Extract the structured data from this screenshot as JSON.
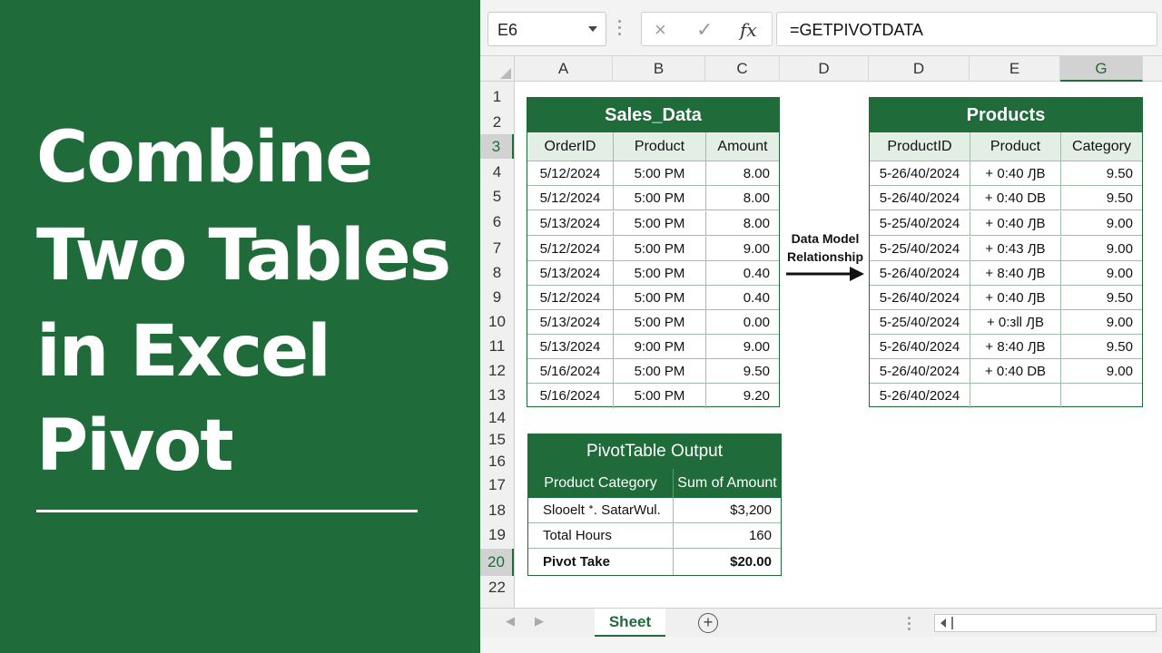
{
  "title_panel": {
    "lines": [
      "Combine",
      "Two Tables",
      "in Excel",
      "Pivot"
    ]
  },
  "formula_bar": {
    "name_box": "E6",
    "cancel_icon": "×",
    "enter_icon": "✓",
    "fx_icon": "fx",
    "formula": "=GETPIVOTDATA"
  },
  "grid": {
    "columns": [
      "A",
      "B",
      "C",
      "D",
      "D",
      "E",
      "G"
    ],
    "rows": [
      "1",
      "2",
      "3",
      "4",
      "5",
      "6",
      "7",
      "8",
      "9",
      "10",
      "11",
      "12",
      "13",
      "14",
      "15",
      "16",
      "17",
      "18",
      "19",
      "20",
      "22"
    ],
    "active_column": "G",
    "active_rows": [
      "3",
      "20"
    ]
  },
  "sales_data": {
    "title": "Sales_Data",
    "headers": [
      "OrderID",
      "Product",
      "Amount"
    ],
    "rows": [
      [
        "5/12/2024",
        "5:00 PM",
        "8.00"
      ],
      [
        "5/12/2024",
        "5:00 PM",
        "8.00"
      ],
      [
        "5/13/2024",
        "5:00 PM",
        "8.00"
      ],
      [
        "5/12/2024",
        "5:00 PM",
        "9.00"
      ],
      [
        "5/13/2024",
        "5:00 PM",
        "0.40"
      ],
      [
        "5/12/2024",
        "5:00 PM",
        "0.40"
      ],
      [
        "5/13/2024",
        "5:00 PM",
        "0.00"
      ],
      [
        "5/13/2024",
        "9:00 PM",
        "9.00"
      ],
      [
        "5/16/2024",
        "5:00 PM",
        "9.50"
      ],
      [
        "5/16/2024",
        "5:00 PM",
        "9.20"
      ]
    ]
  },
  "products": {
    "title": "Products",
    "headers": [
      "ProductID",
      "Product",
      "Category"
    ],
    "rows": [
      [
        "5-26/40/2024",
        "+ 0:40 ԒB",
        "9.50"
      ],
      [
        "5-26/40/2024",
        "+ 0:40 DB",
        "9.50"
      ],
      [
        "5-25/40/2024",
        "+ 0:40 ԒB",
        "9.00"
      ],
      [
        "5-25/40/2024",
        "+ 0:43 ԒB",
        "9.00"
      ],
      [
        "5-26/40/2024",
        "+ 8:40 ԒB",
        "9.00"
      ],
      [
        "5-26/40/2024",
        "+ 0:40 ԒB",
        "9.50"
      ],
      [
        "5-25/40/2024",
        "+ 0:ᴈll ԒB",
        "9.00"
      ],
      [
        "5-26/40/2024",
        "+ 8:40 ԒB",
        "9.50"
      ],
      [
        "5-26/40/2024",
        "+ 0:40 DB",
        "9.00"
      ],
      [
        "5-26/40/2024",
        "",
        ""
      ]
    ]
  },
  "relationship": {
    "label_line1": "Data Model",
    "label_line2": "Relationship"
  },
  "pivot": {
    "title": "PivotTable Output",
    "headers": [
      "Product Category",
      "Sum of Amount"
    ],
    "rows": [
      [
        "Slooelt ᐩ. SatarWul.",
        "$3,200"
      ],
      [
        "Total Hours",
        "160"
      ],
      [
        "Pivot Take",
        "$20.00"
      ]
    ]
  },
  "sheet_bar": {
    "prev_icon": "◀",
    "next_icon": "▶",
    "active_sheet": "Sheet",
    "add_icon": "+"
  },
  "colors": {
    "brand_green": "#1f6b3a",
    "header_fill": "#e3efe5"
  }
}
